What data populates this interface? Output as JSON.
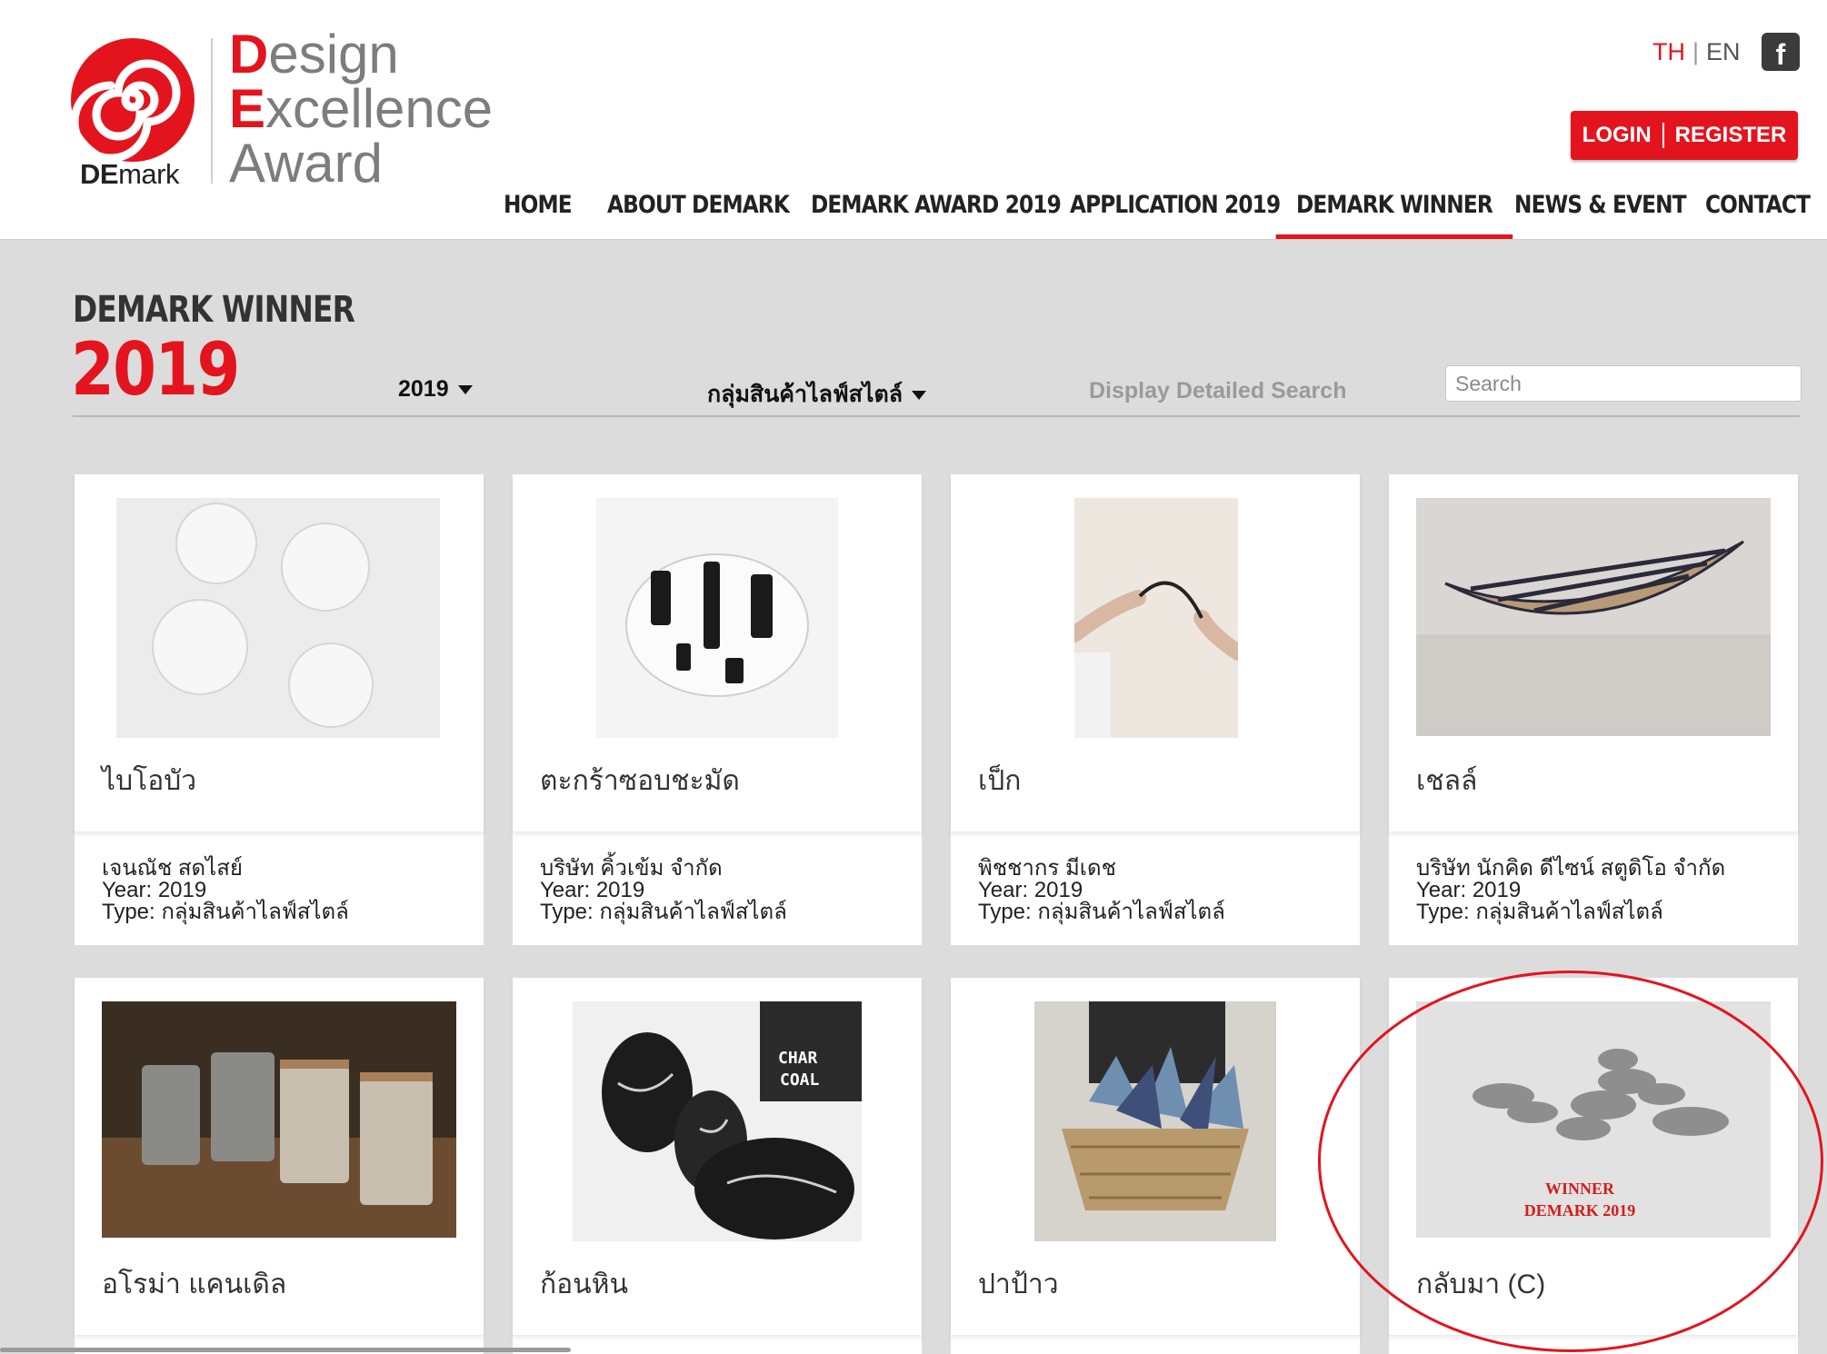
{
  "brand": {
    "logo_name": "DEmark",
    "logo_name_bold": "DE",
    "logo_name_rest": "mark",
    "title_line1_initial": "D",
    "title_line1_rest": "esign",
    "title_line2_initial": "E",
    "title_line2_rest": "xcellence",
    "title_line3": "Award",
    "accent_color": "#e3141d"
  },
  "header": {
    "lang_th": "TH",
    "lang_sep": "|",
    "lang_en": "EN",
    "facebook_icon": "facebook-icon",
    "login_label": "LOGIN",
    "register_label": "REGISTER"
  },
  "nav": {
    "items": [
      {
        "label": "HOME"
      },
      {
        "label": "ABOUT DEMARK"
      },
      {
        "label": "DEMARK AWARD 2019"
      },
      {
        "label": "APPLICATION 2019"
      },
      {
        "label": "DEMARK WINNER"
      },
      {
        "label": "NEWS & EVENT"
      },
      {
        "label": "CONTACT"
      }
    ],
    "active": "DEMARK WINNER"
  },
  "page": {
    "title": "DEMARK WINNER",
    "year": "2019"
  },
  "filters": {
    "year_value": "2019",
    "category_value": "กลุ่มสินค้าไลฟ์สไตล์",
    "detailed_search_label": "Display Detailed Search",
    "search_placeholder": "Search"
  },
  "cards": [
    {
      "name": "ไบโอบัว",
      "maker": "เจนณัช สดไสย์",
      "year": "Year: 2019",
      "type": "Type: กลุ่มสินค้าไลฟ์สไตล์"
    },
    {
      "name": "ตะกร้าซอบชะมัด",
      "maker": "บริษัท คิ้วเข้ม จำกัด",
      "year": "Year: 2019",
      "type": "Type: กลุ่มสินค้าไลฟ์สไตล์"
    },
    {
      "name": "เป็ก",
      "maker": "พิชชากร มีเดช",
      "year": "Year: 2019",
      "type": "Type: กลุ่มสินค้าไลฟ์สไตล์"
    },
    {
      "name": "เชลล์",
      "maker": "บริษัท นักคิด ดีไซน์ สตูดิโอ จำกัด",
      "year": "Year: 2019",
      "type": "Type: กลุ่มสินค้าไลฟ์สไตล์"
    },
    {
      "name": "อโรม่า แคนเดิล"
    },
    {
      "name": "ก้อนหิน",
      "package_text_1": "CHAR",
      "package_text_2": "COAL"
    },
    {
      "name": "ปาป้าว"
    },
    {
      "name": "กลับมา (C)",
      "overlay_line1": "WINNER",
      "overlay_line2": "DEMARK 2019"
    }
  ]
}
